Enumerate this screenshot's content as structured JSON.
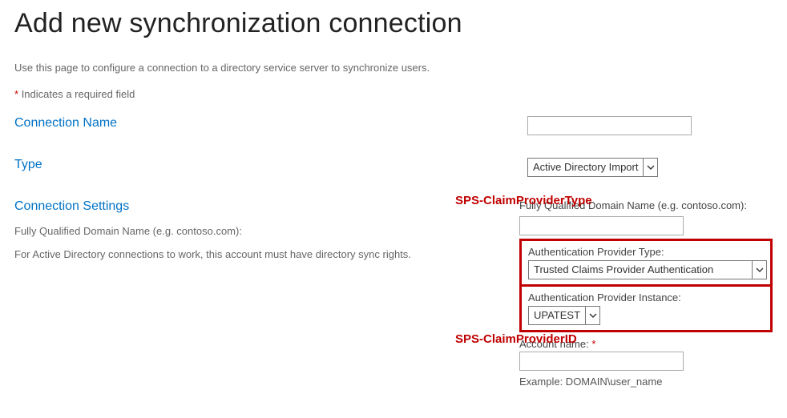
{
  "page": {
    "title": "Add new synchronization connection",
    "intro": "Use this page to configure a connection to a directory service server to synchronize users.",
    "required_note": "Indicates a required field"
  },
  "connection_name": {
    "label": "Connection Name",
    "value": ""
  },
  "type": {
    "label": "Type",
    "selected": "Active Directory Import"
  },
  "settings": {
    "label": "Connection Settings",
    "fqdn_help_label": "Fully Qualified Domain Name (e.g. contoso.com):",
    "rights_help": "For Active Directory connections to work, this account must have directory sync rights.",
    "fqdn_right_label": "Fully Qualified Domain Name (e.g. contoso.com):",
    "fqdn_value": "",
    "auth_type_label": "Authentication Provider Type:",
    "auth_type_selected": "Trusted Claims Provider Authentication",
    "auth_instance_label": "Authentication Provider Instance:",
    "auth_instance_selected": "UPATEST",
    "account_name_label": "Account name:",
    "account_name_value": "",
    "example": "Example: DOMAIN\\user_name"
  },
  "annotations": {
    "sps_claim_provider_type": "SPS-ClaimProviderType",
    "sps_claim_provider_id": "SPS-ClaimProviderID"
  }
}
